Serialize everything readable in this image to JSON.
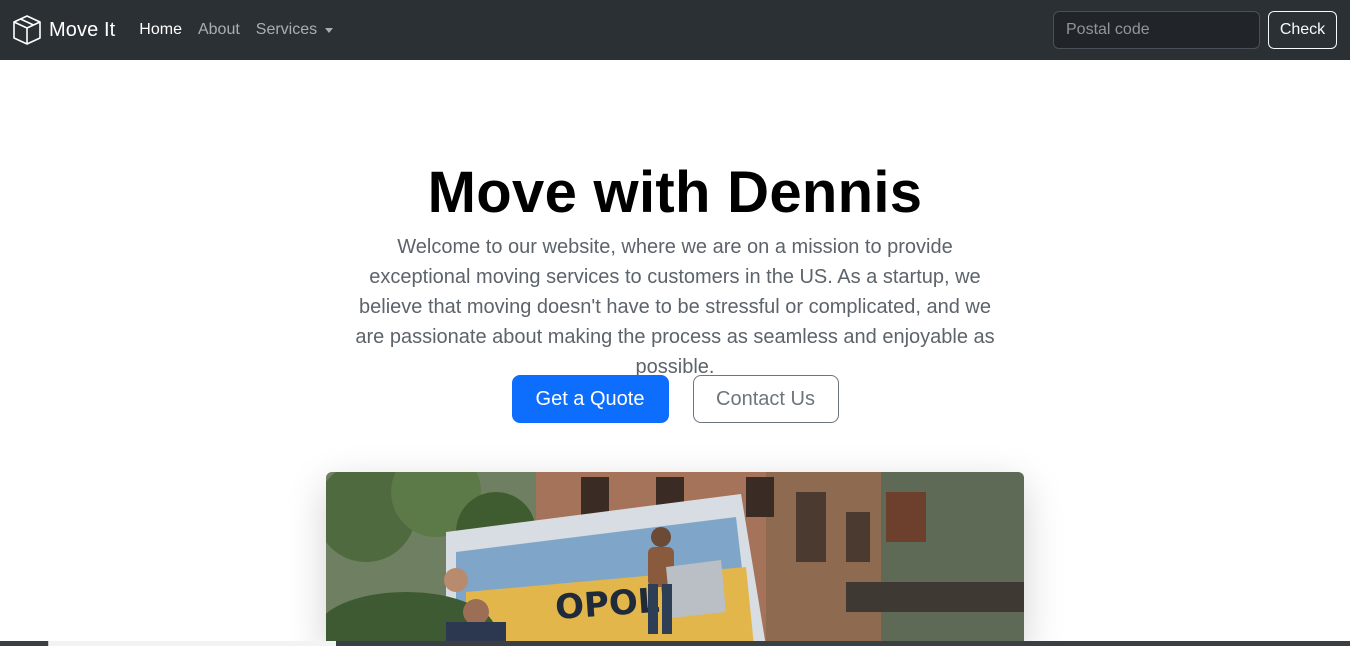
{
  "navbar": {
    "brand": "Move It",
    "brand_icon": "box-icon",
    "links": [
      {
        "label": "Home",
        "active": true
      },
      {
        "label": "About",
        "active": false
      },
      {
        "label": "Services",
        "active": false,
        "dropdown": true
      }
    ],
    "search": {
      "placeholder": "Postal code",
      "value": "",
      "button_label": "Check"
    }
  },
  "hero": {
    "title": "Move with Dennis",
    "lead": "Welcome to our website, where we are on a mission to provide exceptional moving services to customers in the US. As a startup, we believe that moving doesn't have to be stressful or complicated, and we are passionate about making the process as seamless and enjoyable as possible.",
    "primary_button": "Get a Quote",
    "secondary_button": "Contact Us",
    "image_truck_text": "OPOLIS"
  },
  "colors": {
    "navbar_bg": "#2b3035",
    "primary": "#0d6efd",
    "secondary": "#6c757d"
  }
}
